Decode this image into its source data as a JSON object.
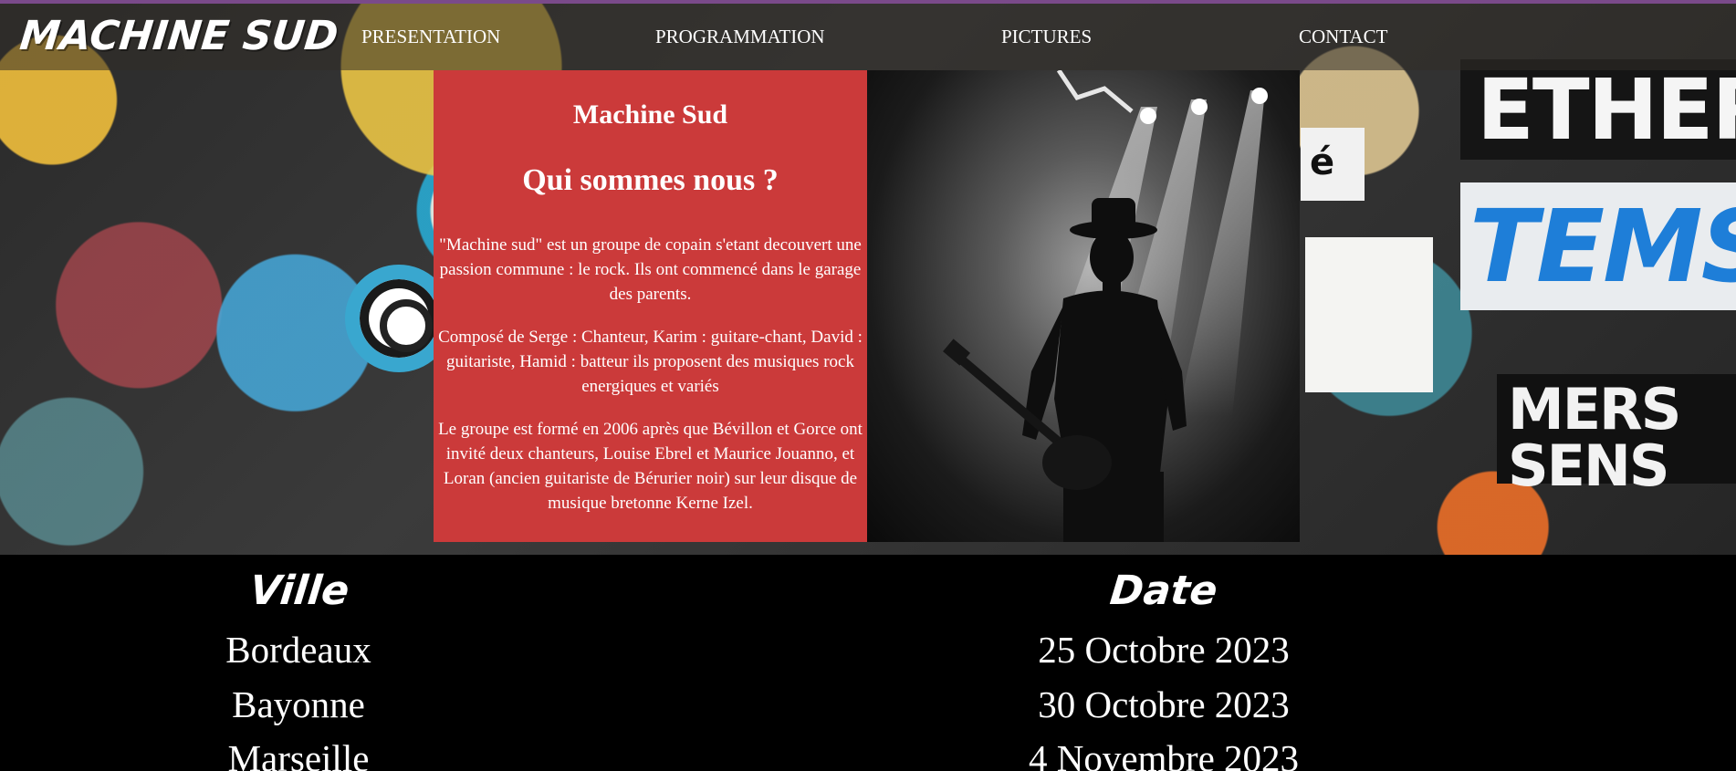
{
  "brand": {
    "logo": "MACHINE SUD"
  },
  "nav": {
    "items": [
      {
        "label": "PRESENTATION"
      },
      {
        "label": "PROGRAMMATION"
      },
      {
        "label": "PICTURES"
      },
      {
        "label": "CONTACT"
      }
    ]
  },
  "about": {
    "band_name": "Machine Sud",
    "heading": "Qui sommes nous ?",
    "paragraphs": [
      "\"Machine sud\" est un groupe de copain s'etant decouvert une passion commune : le rock. Ils ont commencé dans le garage des parents.",
      "Composé de Serge : Chanteur, Karim : guitare-chant, David : guitariste, Hamid : batteur ils proposent des musiques rock energiques et variés",
      "Le groupe est formé en 2006 après que Bévillon et Gorce ont invité deux chanteurs, Louise Ebrel et Maurice Jouanno, et Loran (ancien guitariste de Bérurier noir) sur leur disque de musique bretonne Kerne Izel."
    ]
  },
  "background_posters": {
    "p1": "ETHER",
    "p2": "TEMS",
    "p3": "MERS SENS",
    "p4": "é"
  },
  "tour": {
    "headers": {
      "ville": "Ville",
      "date": "Date"
    },
    "rows": [
      {
        "ville": "Bordeaux",
        "date": "25 Octobre 2023"
      },
      {
        "ville": "Bayonne",
        "date": "30 Octobre 2023"
      },
      {
        "ville": "Marseille",
        "date": "4 Novembre 2023"
      }
    ]
  },
  "colors": {
    "about_bg": "#cb3a3a",
    "page_bg": "#000000",
    "top_strip": "#7a4a8a"
  }
}
